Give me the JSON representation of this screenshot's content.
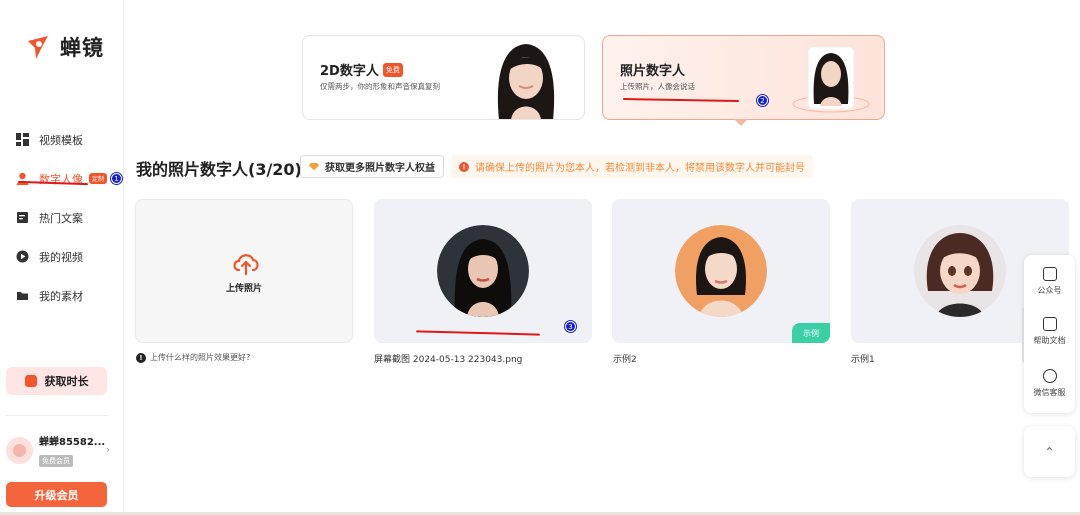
{
  "brand": {
    "name": "蝉镜",
    "accent": "#f2552c"
  },
  "sidebar": {
    "items": [
      {
        "label": "视频模板",
        "icon": "grid-icon"
      },
      {
        "label": "数字人像",
        "icon": "person-icon",
        "badge": "定制",
        "active": true,
        "annotation": "1"
      },
      {
        "label": "热门文案",
        "icon": "document-icon"
      },
      {
        "label": "我的视频",
        "icon": "play-icon"
      },
      {
        "label": "我的素材",
        "icon": "folder-icon"
      }
    ],
    "get_time_label": "获取时长",
    "user": {
      "name": "蝉蝉85582...",
      "level": "免费会员"
    },
    "upgrade_label": "升级会员"
  },
  "modes": [
    {
      "title": "2D数字人",
      "badge": "免费",
      "subtitle": "仅需两步，你的形象和声音保真复刻"
    },
    {
      "title": "照片数字人",
      "subtitle": "上传照片，人像会说话",
      "selected": true,
      "annotation": "2"
    }
  ],
  "section": {
    "title": "我的照片数字人(3/20)",
    "benefit_button": "获取更多照片数字人权益",
    "warning": "请确保上传的照片为您本人，若检测到非本人，将禁用该数字人并可能封号",
    "warning_mark": "!"
  },
  "cards": {
    "upload_label": "上传照片",
    "help_text": "上传什么样的照片效果更好?",
    "help_mark": "!",
    "items": [
      {
        "caption": "屏幕截图 2024-05-13 223043.png",
        "annotation": "3"
      },
      {
        "caption": "示例2",
        "tag": "示例"
      },
      {
        "caption": "示例1"
      }
    ]
  },
  "float_panel": {
    "items": [
      "公众号",
      "帮助文档",
      "微信客服"
    ]
  }
}
